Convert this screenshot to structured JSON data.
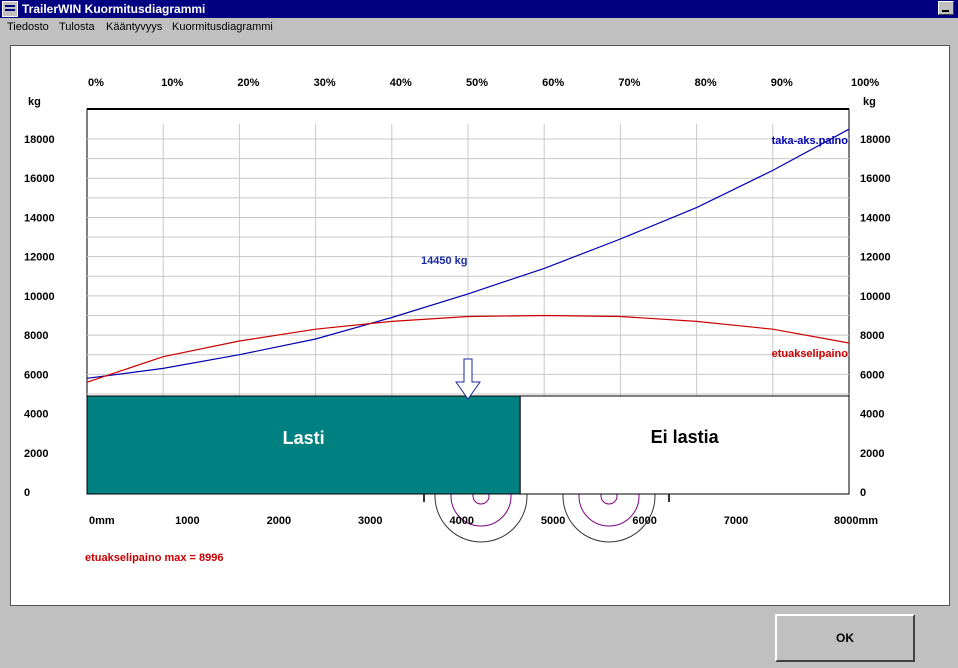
{
  "window": {
    "title": "TrailerWIN Kuormitusdiagrammi"
  },
  "menu": {
    "items": [
      "Tiedosto",
      "Tulosta",
      "Kääntyvyys",
      "Kuormitusdiagrammi"
    ]
  },
  "buttons": {
    "ok_label": "OK"
  },
  "colors": {
    "title_bar": "#000080",
    "face": "#c0c0c0",
    "cargo": "#008080",
    "rear_axle": "#0000b0",
    "front_axle": "#cc0000"
  },
  "chart_data": {
    "type": "line",
    "y_unit_left": "kg",
    "y_unit_right": "kg",
    "ylim": [
      0,
      18000
    ],
    "y_ticks": [
      0,
      2000,
      4000,
      6000,
      8000,
      10000,
      12000,
      14000,
      16000,
      18000
    ],
    "x_top_ticks": [
      "0%",
      "10%",
      "20%",
      "30%",
      "40%",
      "50%",
      "60%",
      "70%",
      "80%",
      "90%",
      "100%"
    ],
    "xlim": [
      0,
      8000
    ],
    "x_bottom_ticks": [
      "0mm",
      "1000",
      "2000",
      "3000",
      "4000",
      "5000",
      "6000",
      "7000",
      "8000mm"
    ],
    "grid": true,
    "series": [
      {
        "name": "taka-aks.paino",
        "color": "#0000b0",
        "x": [
          0,
          800,
          1600,
          2400,
          3200,
          4000,
          4800,
          5600,
          6400,
          7200,
          8000
        ],
        "y": [
          5800,
          6300,
          7000,
          7800,
          8900,
          10100,
          11400,
          12900,
          14500,
          16400,
          18500
        ]
      },
      {
        "name": "etuakselipaino",
        "color": "#cc0000",
        "x": [
          0,
          800,
          1600,
          2400,
          3200,
          4000,
          4800,
          5600,
          6400,
          7200,
          8000
        ],
        "y": [
          5600,
          6900,
          7700,
          8300,
          8700,
          8950,
          9000,
          8950,
          8700,
          8300,
          7600
        ]
      }
    ],
    "annotations": {
      "point_label": "14450 kg",
      "front_axle_max": "etuakselipaino max = 8996"
    },
    "cargo": {
      "loaded_label": "Lasti",
      "empty_label": "Ei lastia",
      "fraction": 0.6
    }
  }
}
